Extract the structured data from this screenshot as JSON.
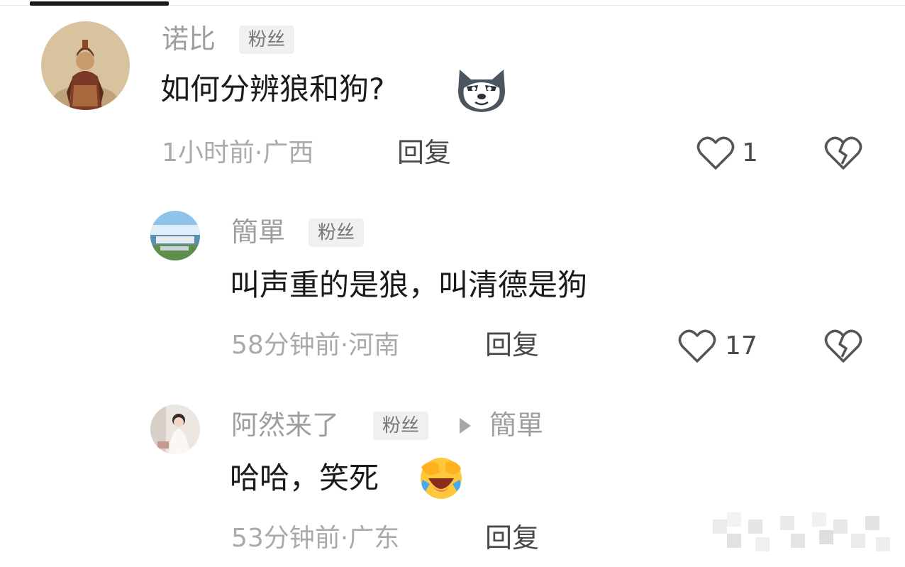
{
  "comments": [
    {
      "name": "诺比",
      "badge": "粉丝",
      "text": "如何分辨狼和狗?",
      "emoji": "wolf-face-emoji",
      "meta": "1小时前·广西",
      "reply": "回复",
      "likes": "1"
    },
    {
      "name": "簡單",
      "badge": "粉丝",
      "text": "叫声重的是狼，叫清德是狗",
      "meta": "58分钟前·河南",
      "reply": "回复",
      "likes": "17"
    },
    {
      "name": "阿然来了",
      "badge": "粉丝",
      "reply_to": "簡單",
      "text": "哈哈，笑死",
      "emoji": "laughing-crying-emoji",
      "meta": "53分钟前·广东",
      "reply": "回复"
    }
  ],
  "icons": [
    "heart-outline-icon",
    "broken-heart-icon",
    "play-arrow-icon"
  ],
  "colors": {
    "text": "#1a1a1a",
    "meta": "#aaaaaa",
    "badge_bg": "#f0f0f0",
    "icon": "#555555"
  }
}
